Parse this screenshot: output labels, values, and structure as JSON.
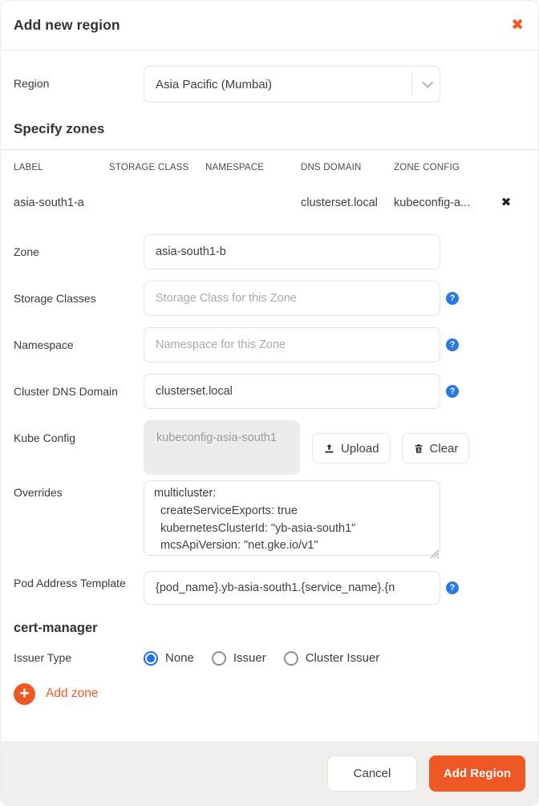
{
  "colors": {
    "accent_orange": "#ef5824",
    "help_blue": "#2b78e4",
    "radio_blue": "#2173eb",
    "footer_bg": "#f0efeb"
  },
  "header": {
    "title": "Add new region",
    "close_icon": "✖"
  },
  "region": {
    "label": "Region",
    "value": "Asia Pacific (Mumbai)"
  },
  "zones_section": {
    "heading": "Specify zones",
    "table": {
      "columns": [
        "LABEL",
        "STORAGE CLASS",
        "NAMESPACE",
        "DNS DOMAIN",
        "ZONE CONFIG"
      ],
      "rows": [
        {
          "label": "asia-south1-a",
          "storage_class": "",
          "namespace": "",
          "dns_domain": "clusterset.local",
          "zone_config": "kubeconfig-a...",
          "remove_icon": "✖"
        }
      ]
    }
  },
  "form": {
    "zone": {
      "label": "Zone",
      "value": "asia-south1-b"
    },
    "storage_classes": {
      "label": "Storage Classes",
      "placeholder": "Storage Class for this Zone",
      "help_icon": "?"
    },
    "namespace": {
      "label": "Namespace",
      "placeholder": "Namespace for this Zone",
      "help_icon": "?"
    },
    "dns_domain": {
      "label": "Cluster DNS Domain",
      "value": "clusterset.local",
      "help_icon": "?"
    },
    "kube_config": {
      "label": "Kube Config",
      "file_name": "kubeconfig-asia-south1",
      "upload_label": "Upload",
      "clear_label": "Clear"
    },
    "overrides": {
      "label": "Overrides",
      "value": "multicluster:\n  createServiceExports: true\n  kubernetesClusterId: \"yb-asia-south1\"\n  mcsApiVersion: \"net.gke.io/v1\""
    },
    "pod_address_template": {
      "label": "Pod Address Template",
      "value": "{pod_name}.yb-asia-south1.{service_name}.{n",
      "help_icon": "?"
    }
  },
  "cert_manager": {
    "heading": "cert-manager",
    "issuer_type": {
      "label": "Issuer Type",
      "options": [
        {
          "label": "None",
          "selected": true
        },
        {
          "label": "Issuer",
          "selected": false
        },
        {
          "label": "Cluster Issuer",
          "selected": false
        }
      ]
    }
  },
  "add_zone": {
    "label": "Add zone",
    "plus_icon": "+"
  },
  "footer": {
    "cancel_label": "Cancel",
    "submit_label": "Add Region"
  }
}
